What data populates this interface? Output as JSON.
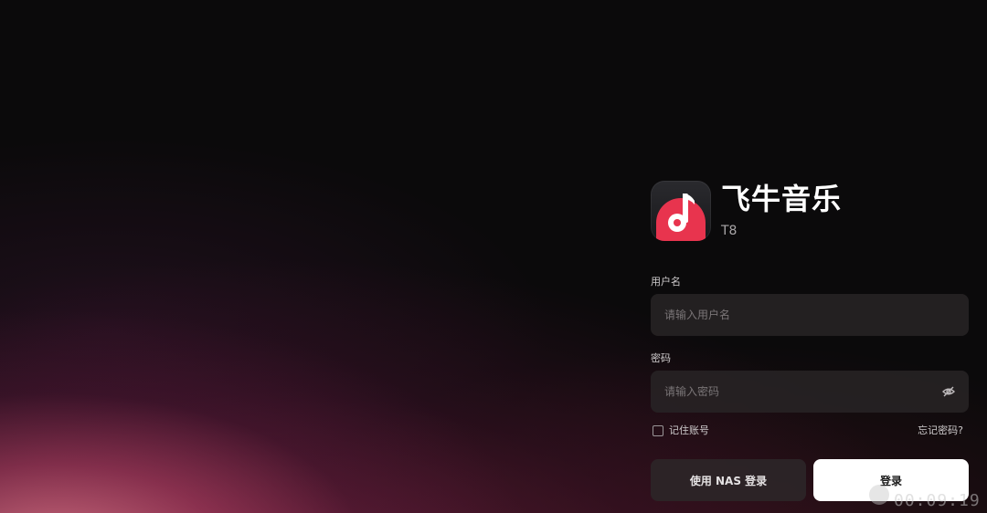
{
  "app": {
    "name": "飞牛音乐",
    "subtitle": "T8",
    "icon": "music-note-app-icon",
    "accent_color": "#e8344e"
  },
  "form": {
    "username": {
      "label": "用户名",
      "placeholder": "请输入用户名",
      "value": ""
    },
    "password": {
      "label": "密码",
      "placeholder": "请输入密码",
      "value": "",
      "toggle_icon": "eye-off-icon"
    },
    "remember_label": "记住账号",
    "remember_checked": false,
    "forgot_label": "忘记密码?"
  },
  "buttons": {
    "nas_login_label": "使用 NAS 登录",
    "login_label": "登录"
  },
  "overlay": {
    "timestamp": "00:09:19"
  },
  "colors": {
    "background": "#0b0a0b",
    "input_background": "#282426",
    "primary_button": "#ffffff",
    "secondary_button": "#2c2628"
  }
}
